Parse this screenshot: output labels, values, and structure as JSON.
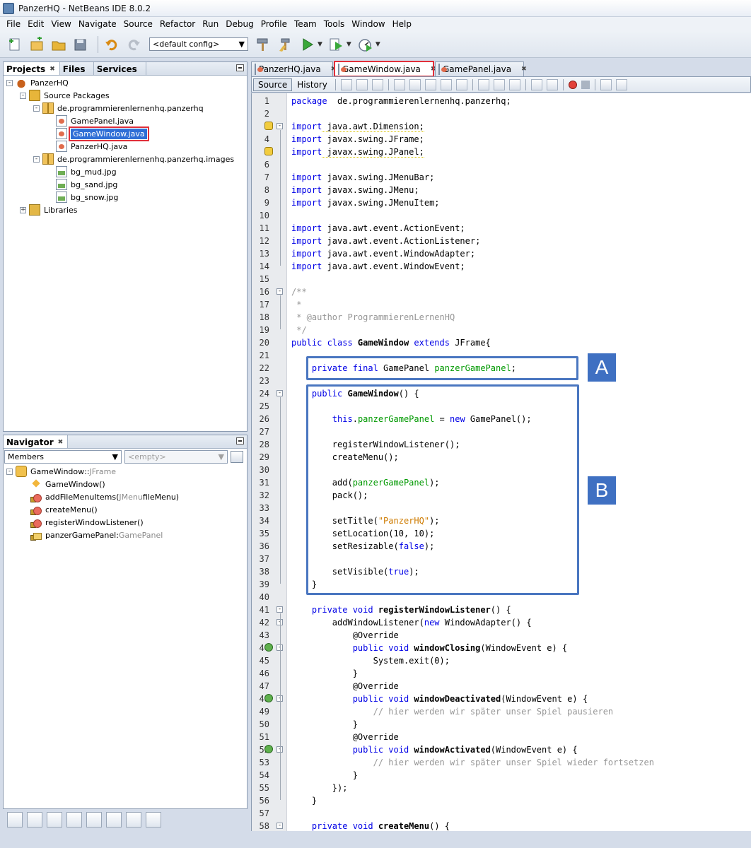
{
  "window": {
    "title": "PanzerHQ - NetBeans IDE 8.0.2"
  },
  "menu": [
    "File",
    "Edit",
    "View",
    "Navigate",
    "Source",
    "Refactor",
    "Run",
    "Debug",
    "Profile",
    "Team",
    "Tools",
    "Window",
    "Help"
  ],
  "toolbar": {
    "config": "<default config>"
  },
  "projects_panel": {
    "tabs": [
      "Projects",
      "Files",
      "Services"
    ],
    "tree": [
      {
        "label": "PanzerHQ",
        "icon": "coffee-icon",
        "level": 0,
        "expander": "-"
      },
      {
        "label": "Source Packages",
        "icon": "folder-icon",
        "level": 1,
        "expander": "-"
      },
      {
        "label": "de.programmierenlernenhq.panzerhq",
        "icon": "package-icon",
        "level": 2,
        "expander": "-"
      },
      {
        "label": "GamePanel.java",
        "icon": "java-file-icon",
        "level": 3
      },
      {
        "label": "GameWindow.java",
        "icon": "java-file-icon",
        "level": 3,
        "selected": true
      },
      {
        "label": "PanzerHQ.java",
        "icon": "java-file-icon",
        "level": 3
      },
      {
        "label": "de.programmierenlernenhq.panzerhq.images",
        "icon": "package-icon",
        "level": 2,
        "expander": "-"
      },
      {
        "label": "bg_mud.jpg",
        "icon": "image-file-icon",
        "level": 3
      },
      {
        "label": "bg_sand.jpg",
        "icon": "image-file-icon",
        "level": 3
      },
      {
        "label": "bg_snow.jpg",
        "icon": "image-file-icon",
        "level": 3
      },
      {
        "label": "Libraries",
        "icon": "library-icon",
        "level": 1,
        "expander": "+"
      }
    ]
  },
  "navigator": {
    "title": "Navigator",
    "filter": "Members",
    "empty": "<empty>",
    "root": {
      "name": "GameWindow",
      "sep": " :: ",
      "type": "JFrame"
    },
    "members": [
      {
        "name": "GameWindow()",
        "kind": "constructor-icon"
      },
      {
        "name": "addFileMenuItems(",
        "type": "JMenu",
        "rest": " fileMenu)",
        "kind": "method-icon"
      },
      {
        "name": "createMenu()",
        "kind": "method-icon"
      },
      {
        "name": "registerWindowListener()",
        "kind": "method-icon"
      },
      {
        "name": "panzerGamePanel",
        "sep": " : ",
        "type": "GamePanel",
        "kind": "field-icon"
      }
    ]
  },
  "editor": {
    "tabs": [
      "PanzerHQ.java",
      "GameWindow.java",
      "GamePanel.java"
    ],
    "active_tab": 1,
    "source_label": "Source",
    "history_label": "History",
    "annotations": [
      "A",
      "B"
    ],
    "lines": [
      {
        "n": "1",
        "t": [
          [
            "kw",
            "package"
          ],
          [
            "",
            "  de.programmierenlernenhq.panzerhq;"
          ]
        ]
      },
      {
        "n": "2",
        "t": []
      },
      {
        "n": "3",
        "mark": "warn",
        "fold": "-",
        "t": [
          [
            "kw",
            "import"
          ],
          [
            "u",
            " java.awt.Dimension;"
          ]
        ]
      },
      {
        "n": "4",
        "t": [
          [
            "kw",
            "import"
          ],
          [
            "",
            " javax.swing.JFrame;"
          ]
        ]
      },
      {
        "n": "5",
        "mark": "warn",
        "t": [
          [
            "kw",
            "import"
          ],
          [
            "u",
            " javax.swing.JPanel;"
          ]
        ]
      },
      {
        "n": "6",
        "t": []
      },
      {
        "n": "7",
        "t": [
          [
            "kw",
            "import"
          ],
          [
            "",
            " javax.swing.JMenuBar;"
          ]
        ]
      },
      {
        "n": "8",
        "t": [
          [
            "kw",
            "import"
          ],
          [
            "",
            " javax.swing.JMenu;"
          ]
        ]
      },
      {
        "n": "9",
        "t": [
          [
            "kw",
            "import"
          ],
          [
            "",
            " javax.swing.JMenuItem;"
          ]
        ]
      },
      {
        "n": "10",
        "t": []
      },
      {
        "n": "11",
        "t": [
          [
            "kw",
            "import"
          ],
          [
            "",
            " java.awt.event.ActionEvent;"
          ]
        ]
      },
      {
        "n": "12",
        "t": [
          [
            "kw",
            "import"
          ],
          [
            "",
            " java.awt.event.ActionListener;"
          ]
        ]
      },
      {
        "n": "13",
        "t": [
          [
            "kw",
            "import"
          ],
          [
            "",
            " java.awt.event.WindowAdapter;"
          ]
        ]
      },
      {
        "n": "14",
        "t": [
          [
            "kw",
            "import"
          ],
          [
            "",
            " java.awt.event.WindowEvent;"
          ]
        ]
      },
      {
        "n": "15",
        "t": []
      },
      {
        "n": "16",
        "fold": "-",
        "t": [
          [
            "cmt",
            "/**"
          ]
        ]
      },
      {
        "n": "17",
        "t": [
          [
            "cmt",
            " *"
          ]
        ]
      },
      {
        "n": "18",
        "t": [
          [
            "cmt",
            " * @author ProgrammierenLernenHQ"
          ]
        ]
      },
      {
        "n": "19",
        "t": [
          [
            "cmt",
            " */"
          ]
        ]
      },
      {
        "n": "20",
        "t": [
          [
            "kw",
            "public class"
          ],
          [
            "b",
            " GameWindow"
          ],
          [
            "kw",
            " extends"
          ],
          [
            "",
            " JFrame{"
          ]
        ]
      },
      {
        "n": "21",
        "t": []
      },
      {
        "n": "22",
        "t": [
          [
            "",
            "    "
          ],
          [
            "kw",
            "private final"
          ],
          [
            "",
            " GamePanel "
          ],
          [
            "fld",
            "panzerGamePanel"
          ],
          [
            "",
            ";"
          ]
        ]
      },
      {
        "n": "23",
        "t": []
      },
      {
        "n": "24",
        "fold": "-",
        "t": [
          [
            "",
            "    "
          ],
          [
            "kw",
            "public"
          ],
          [
            "b",
            " GameWindow"
          ],
          [
            "",
            "() {"
          ]
        ]
      },
      {
        "n": "25",
        "t": []
      },
      {
        "n": "26",
        "t": [
          [
            "",
            "        "
          ],
          [
            "kw",
            "this"
          ],
          [
            "",
            "."
          ],
          [
            "fld",
            "panzerGamePanel"
          ],
          [
            "",
            " = "
          ],
          [
            "kw",
            "new"
          ],
          [
            "",
            " GamePanel();"
          ]
        ]
      },
      {
        "n": "27",
        "t": []
      },
      {
        "n": "28",
        "t": [
          [
            "",
            "        registerWindowListener();"
          ]
        ]
      },
      {
        "n": "29",
        "t": [
          [
            "",
            "        createMenu();"
          ]
        ]
      },
      {
        "n": "30",
        "t": []
      },
      {
        "n": "31",
        "t": [
          [
            "",
            "        add("
          ],
          [
            "fld",
            "panzerGamePanel"
          ],
          [
            "",
            ");"
          ]
        ]
      },
      {
        "n": "32",
        "t": [
          [
            "",
            "        pack();"
          ]
        ]
      },
      {
        "n": "33",
        "t": []
      },
      {
        "n": "34",
        "t": [
          [
            "",
            "        setTitle("
          ],
          [
            "str",
            "\"PanzerHQ\""
          ],
          [
            "",
            ");"
          ]
        ]
      },
      {
        "n": "35",
        "t": [
          [
            "",
            "        setLocation(10, 10);"
          ]
        ]
      },
      {
        "n": "36",
        "t": [
          [
            "",
            "        setResizable("
          ],
          [
            "kw",
            "false"
          ],
          [
            "",
            ");"
          ]
        ]
      },
      {
        "n": "37",
        "t": []
      },
      {
        "n": "38",
        "t": [
          [
            "",
            "        setVisible("
          ],
          [
            "kw",
            "true"
          ],
          [
            "",
            ");"
          ]
        ]
      },
      {
        "n": "39",
        "t": [
          [
            "",
            "    }"
          ]
        ]
      },
      {
        "n": "40",
        "t": []
      },
      {
        "n": "41",
        "fold": "-",
        "t": [
          [
            "",
            "    "
          ],
          [
            "kw",
            "private void"
          ],
          [
            "b",
            " registerWindowListener"
          ],
          [
            "",
            "() {"
          ]
        ]
      },
      {
        "n": "42",
        "fold": "-",
        "t": [
          [
            "",
            "        addWindowListener("
          ],
          [
            "kw",
            "new"
          ],
          [
            "",
            " WindowAdapter() {"
          ]
        ]
      },
      {
        "n": "43",
        "t": [
          [
            "",
            "            @Override"
          ]
        ]
      },
      {
        "n": "44",
        "mark": "ovr",
        "fold": "-",
        "t": [
          [
            "",
            "            "
          ],
          [
            "kw",
            "public void"
          ],
          [
            "b",
            " windowClosing"
          ],
          [
            "",
            "(WindowEvent e) {"
          ]
        ]
      },
      {
        "n": "45",
        "t": [
          [
            "",
            "                System.exit(0);"
          ]
        ]
      },
      {
        "n": "46",
        "t": [
          [
            "",
            "            }"
          ]
        ]
      },
      {
        "n": "47",
        "t": [
          [
            "",
            "            @Override"
          ]
        ]
      },
      {
        "n": "48",
        "mark": "ovr",
        "fold": "-",
        "t": [
          [
            "",
            "            "
          ],
          [
            "kw",
            "public void"
          ],
          [
            "b",
            " windowDeactivated"
          ],
          [
            "",
            "(WindowEvent e) {"
          ]
        ]
      },
      {
        "n": "49",
        "t": [
          [
            "",
            "                "
          ],
          [
            "cmt",
            "// hier werden wir später unser Spiel pausieren"
          ]
        ]
      },
      {
        "n": "50",
        "t": [
          [
            "",
            "            }"
          ]
        ]
      },
      {
        "n": "51",
        "t": [
          [
            "",
            "            @Override"
          ]
        ]
      },
      {
        "n": "52",
        "mark": "ovr",
        "fold": "-",
        "t": [
          [
            "",
            "            "
          ],
          [
            "kw",
            "public void"
          ],
          [
            "b",
            " windowActivated"
          ],
          [
            "",
            "(WindowEvent e) {"
          ]
        ]
      },
      {
        "n": "53",
        "t": [
          [
            "",
            "                "
          ],
          [
            "cmt",
            "// hier werden wir später unser Spiel wieder fortsetzen"
          ]
        ]
      },
      {
        "n": "54",
        "t": [
          [
            "",
            "            }"
          ]
        ]
      },
      {
        "n": "55",
        "t": [
          [
            "",
            "        });"
          ]
        ]
      },
      {
        "n": "56",
        "t": [
          [
            "",
            "    }"
          ]
        ]
      },
      {
        "n": "57",
        "t": []
      },
      {
        "n": "58",
        "fold": "-",
        "t": [
          [
            "",
            "    "
          ],
          [
            "kw",
            "private void"
          ],
          [
            "b",
            " createMenu"
          ],
          [
            "",
            "() {"
          ]
        ]
      }
    ]
  }
}
